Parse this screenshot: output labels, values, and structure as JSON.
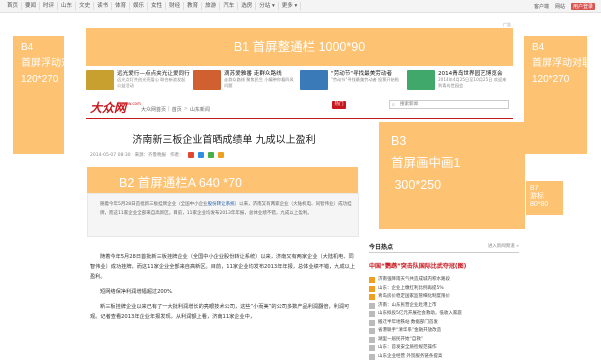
{
  "top_nav": {
    "items": [
      "首页",
      "要闻",
      "时评",
      "山东",
      "文史",
      "读书",
      "体育",
      "娱乐",
      "女性",
      "财经",
      "教育",
      "旅游",
      "汽车",
      "选房",
      "分站 ▾",
      "更多 ▾"
    ],
    "right": [
      "客户端",
      "网站"
    ],
    "user_button": "用户登录"
  },
  "ads": {
    "b1": "B1 首屏整通栏 1000*90",
    "b4_left": "B4\n首屏浮动对联\n120*270",
    "b4_right": "B4\n首屏浮动对联\n120*270",
    "b2": "B2 首屏通栏A 640 *70",
    "b3": "B3\n首屏画中画1\n 300*250",
    "b7": "B7\n游标\n80*80",
    "b1_small_label": "广告"
  },
  "promo": [
    {
      "title": "远光爱行—点点夹光让爱同行",
      "desc": "远光点灯共创光亮爱心 联合新浪发起公益活动",
      "color": "#c8a030"
    },
    {
      "title": "滴苏爱雅番 走群众路线",
      "desc": "走群众路线 聚焦民生 小编带你看四风问题",
      "color": "#d06030"
    },
    {
      "title": "\"劳动节\"寻找最美劳动者",
      "desc": "\"劳动节\"寻找最美劳动者 投票开始啦",
      "color": "#3a7ab8"
    },
    {
      "title": "2014青岛世界园艺博览会",
      "desc": "2014年4月25日至10月25日 欢迎来到青岛世园会",
      "color": "#3fa86a"
    }
  ],
  "logo": {
    "text": "大众网",
    "sub": "dzwww.com"
  },
  "breadcrumb": [
    "大众网首页",
    "首页",
    "山东新闻"
  ],
  "hot_button": "热门",
  "search": {
    "placeholder": "搜索新闻"
  },
  "article": {
    "title": "济南新三板企业首晒成绩单 九成以上盈利",
    "date": "2014-05-07 08:30",
    "source": "来源：齐鲁晚报",
    "editor": "作者：",
    "summary_pre": "随着今年5月28日首批新三板挂牌企业（全国中小企业",
    "summary_link": "股份转让系统",
    "summary_post": "）以来，济南又有两家企业（大陆机电、同智伟业）成功挂牌，而这11家企业全部来自高新区。目前，11家企业均发布2013年年报，总体业绩不错，九成以上盈利。",
    "paragraphs": [
      "随着今年5月28日首批新三板挂牌企业（全国中小企业股份转让系统）以来，济南又有两家企业（大陆机电、同智伟业）成功挂牌，而这11家企业全部来自高新区。目前，11家企业均发布2013年年报，总体业绩不错，九成以上盈利。",
      "短网络保净利润增幅超过200%",
      "新三板挂牌企业以来已有了一大批利润增长的亮眼技术公司，这些“小而美”的公司多数产品利润翻倍，利润可观。记者查看2013年企业年报发现，从利润额上看，济南11家企业中，"
    ]
  },
  "sidebar": {
    "heading": "今日热点",
    "more": "进入新闻频道 »",
    "top_headline": "中国“鹦鹉”突击队国际比武夺冠(图)",
    "hot_list": [
      "济南强降雨天气共造成城内积水路段",
      "山东：企业上缴红利比例再提5%",
      "青岛房价稳定国家监管细化制度限价",
      "济南：山东民营企业赴港上市",
      "山东拟投5亿元开展社会救助，低收入家庭",
      "搬迁半年地铁站 数据部门首发",
      "省港联手“清华系”金融开放改造",
      "湖里一居民开始“自救”",
      "山东：首发安全质检规范操作",
      "山东企业经营 外贸服务链条提高"
    ]
  },
  "colors": {
    "accent": "#c8161d",
    "ad": "#fdc272",
    "link": "#1a56a6"
  }
}
